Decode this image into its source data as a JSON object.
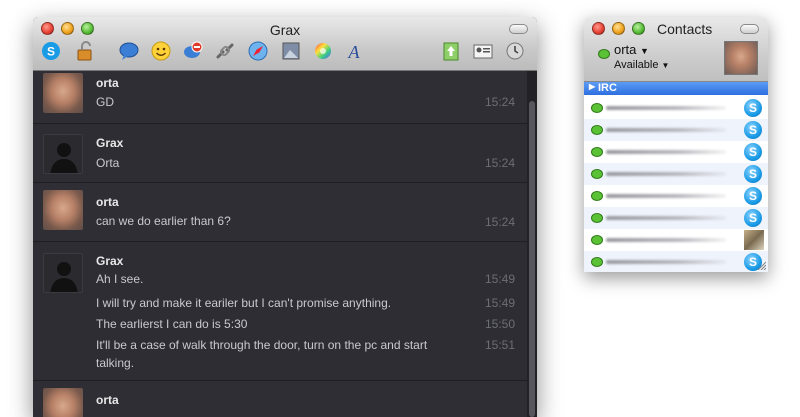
{
  "chat_window": {
    "title": "Grax",
    "messages": [
      {
        "sender": "orta",
        "avatar": "photo",
        "lines": [
          {
            "text": "GD",
            "time": "15:24"
          }
        ]
      },
      {
        "sender": "Grax",
        "avatar": "silhouette",
        "lines": [
          {
            "text": "Orta",
            "time": "15:24"
          }
        ]
      },
      {
        "sender": "orta",
        "avatar": "photo",
        "lines": [
          {
            "text": "can we do earlier than 6?",
            "time": "15:24"
          }
        ]
      },
      {
        "sender": "Grax",
        "avatar": "silhouette",
        "lines": [
          {
            "text": "Ah I see.",
            "time": "15:49"
          },
          {
            "text": "I will try and make it eariler but I can't promise anything.",
            "time": "15:49"
          },
          {
            "text": "The earlierst I can do is 5:30",
            "time": "15:50"
          },
          {
            "text": "It'll be a case of walk through the door, turn on the pc and start talking.",
            "time": "15:51"
          }
        ]
      },
      {
        "sender": "orta",
        "avatar": "photo",
        "lines": []
      }
    ],
    "toolbar_icons": [
      "skype-icon",
      "lock-icon",
      "chat-bubble-icon",
      "smiley-icon",
      "block-icon",
      "link-icon",
      "safari-icon",
      "image-icon",
      "color-wheel-icon",
      "font-icon",
      "send-file-icon",
      "contact-card-icon",
      "history-icon"
    ]
  },
  "contacts_window": {
    "title": "Contacts",
    "user_name": "orta",
    "status": "Available",
    "group_name": "IRC",
    "contacts": [
      {
        "badge": "skype",
        "status_color": "#5bc236"
      },
      {
        "badge": "skype",
        "status_color": "#5bc236"
      },
      {
        "badge": "skype",
        "status_color": "#5bc236"
      },
      {
        "badge": "skype",
        "status_color": "#5bc236"
      },
      {
        "badge": "skype",
        "status_color": "#5bc236"
      },
      {
        "badge": "skype",
        "status_color": "#5bc236"
      },
      {
        "badge": "photo",
        "status_color": "#5bc236"
      },
      {
        "badge": "skype",
        "status_color": "#5bc236"
      }
    ]
  },
  "colors": {
    "chat_background": "#2d2d33",
    "selection_blue": "#2e6fe0",
    "status_green": "#5bc236"
  }
}
